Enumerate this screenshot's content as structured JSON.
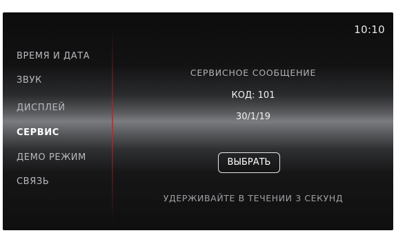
{
  "status_bar": {
    "time": "10:10"
  },
  "sidebar": {
    "items": [
      {
        "label": "ВРЕМЯ И ДАТА",
        "active": false
      },
      {
        "label": "ЗВУК",
        "active": false
      },
      {
        "label": "ДИСПЛЕЙ",
        "active": false
      },
      {
        "label": "СЕРВИС",
        "active": true
      },
      {
        "label": "ДЕМО РЕЖИМ",
        "active": false
      },
      {
        "label": "СВЯЗЬ",
        "active": false
      }
    ]
  },
  "main": {
    "message_title": "СЕРВИСНОЕ СООБЩЕНИЕ",
    "code_line": "КОД: 101",
    "date": "30/1/19",
    "select_button_label": "ВЫБРАТЬ",
    "hint": "УДЕРЖИВАЙТЕ В ТЕЧЕНИИ 3 СЕКУНД"
  },
  "colors": {
    "accent_divider": "#c82828",
    "active_text": "#ffffff",
    "inactive_text": "#b9babd"
  }
}
